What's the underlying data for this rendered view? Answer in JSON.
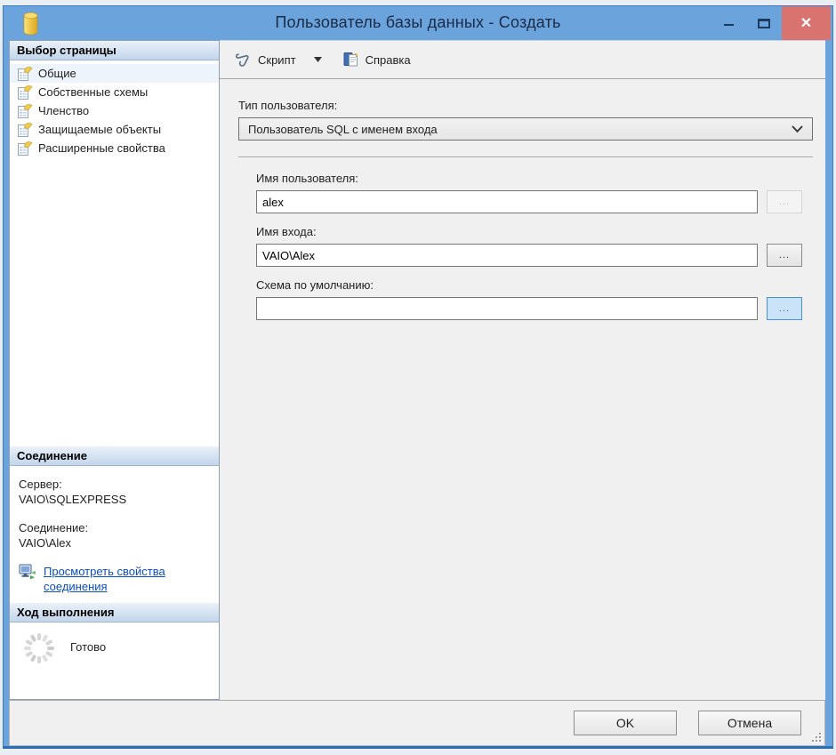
{
  "window": {
    "title": "Пользователь базы данных - Создать",
    "close_glyph": "✕"
  },
  "toolbar": {
    "script_label": "Скрипт",
    "help_label": "Справка"
  },
  "sidebar": {
    "pages_header": "Выбор страницы",
    "pages": [
      {
        "label": "Общие"
      },
      {
        "label": "Собственные схемы"
      },
      {
        "label": "Членство"
      },
      {
        "label": "Защищаемые объекты"
      },
      {
        "label": "Расширенные свойства"
      }
    ],
    "connection_header": "Соединение",
    "server_label": "Сервер:",
    "server_value": "VAIO\\SQLEXPRESS",
    "connection_label": "Соединение:",
    "connection_value": "VAIO\\Alex",
    "view_connection_link": "Просмотреть свойства соединения",
    "progress_header": "Ход выполнения",
    "progress_status": "Готово"
  },
  "form": {
    "user_type_label": "Тип пользователя:",
    "user_type_value": "Пользователь SQL с именем входа",
    "user_name_label": "Имя пользователя:",
    "user_name_value": "alex",
    "login_name_label": "Имя входа:",
    "login_name_value": "VAIO\\Alex",
    "default_schema_label": "Схема по умолчанию:",
    "default_schema_value": "",
    "browse_label": "..."
  },
  "footer": {
    "ok_label": "OK",
    "cancel_label": "Отмена"
  },
  "colors": {
    "titlebar_blue": "#6ba3dd",
    "close_red": "#d97370",
    "link_blue": "#0b4fc0",
    "panel_gray": "#f0f0f0",
    "header_gradient_bottom": "#c2d5ea",
    "focused_browse_blue": "#cbe3f9"
  }
}
